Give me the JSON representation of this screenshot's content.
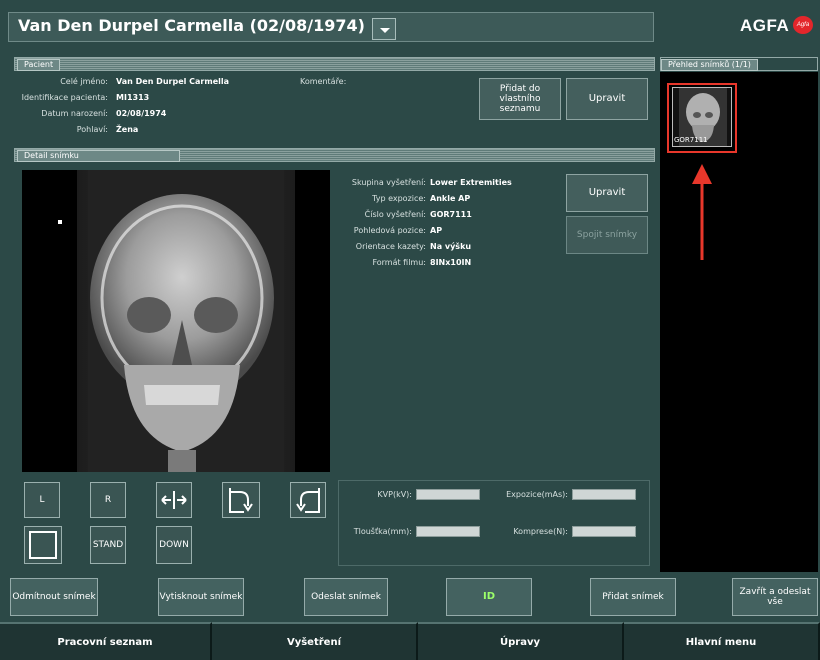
{
  "window": {
    "title": "Van Den Durpel Carmella (02/08/1974)",
    "logo_text": "AGFA",
    "logo_badge": "Agfa"
  },
  "patient_section": {
    "header": "Pacient",
    "fields": [
      {
        "label": "Celé jméno:",
        "value": "Van Den Durpel Carmella"
      },
      {
        "label": "Identifikace pacienta:",
        "value": "MI1313"
      },
      {
        "label": "Datum narození:",
        "value": "02/08/1974"
      },
      {
        "label": "Pohlaví:",
        "value": "Žena"
      }
    ],
    "comment_label": "Komentáře:",
    "add_button": "Přidat do vlastního seznamu",
    "edit_button": "Upravit"
  },
  "image_section": {
    "header": "Detail snímku",
    "fields": [
      {
        "label": "Skupina vyšetření:",
        "value": "Lower Extremities"
      },
      {
        "label": "Typ expozice:",
        "value": "Ankle AP"
      },
      {
        "label": "Číslo vyšetření:",
        "value": "GOR7111"
      },
      {
        "label": "Pohledová pozice:",
        "value": "AP"
      },
      {
        "label": "Orientace kazety:",
        "value": "Na výšku"
      },
      {
        "label": "Formát filmu:",
        "value": "8INx10IN"
      }
    ],
    "edit_button": "Upravit",
    "join_button": "Spojit snímky",
    "orientation_buttons": {
      "left": "L",
      "right": "R",
      "stand": "STAND",
      "down": "DOWN"
    },
    "exposure": {
      "kvp_label": "KVP(kV):",
      "kvp_value": "",
      "mas_label": "Expozice(mAs):",
      "mas_value": "",
      "thickness_label": "Tloušťka(mm):",
      "thickness_value": "",
      "compression_label": "Komprese(N):",
      "compression_value": ""
    }
  },
  "overview": {
    "header": "Přehled snímků (1/1)",
    "thumbnail_label": "GOR7111"
  },
  "actions": {
    "reject": "Odmítnout snímek",
    "print": "Vytisknout snímek",
    "send": "Odeslat snímek",
    "id": "ID",
    "add": "Přidat snímek",
    "close_send_all": "Zavřít a odeslat vše"
  },
  "nav": {
    "tabs": [
      "Pracovní seznam",
      "Vyšetření",
      "Úpravy",
      "Hlavní menu"
    ]
  },
  "colors": {
    "background": "#2c4947",
    "id_button_text": "#9cff6a",
    "highlight": "#e8372b"
  }
}
